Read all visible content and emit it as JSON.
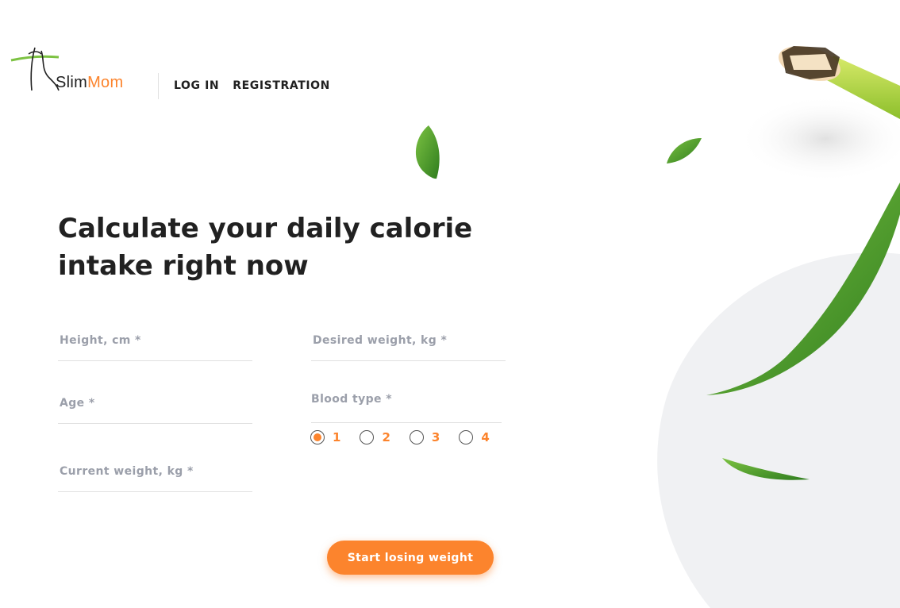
{
  "header": {
    "logo": {
      "text_slim": "Slim",
      "text_mom": "Mom"
    },
    "nav": [
      {
        "label": "LOG IN"
      },
      {
        "label": "REGISTRATION"
      }
    ]
  },
  "main": {
    "title": "Calculate your daily calorie intake right now",
    "form": {
      "height_placeholder": "Height, cm *",
      "age_placeholder": "Age *",
      "current_weight_placeholder": "Current weight, kg *",
      "desired_weight_placeholder": "Desired weight, kg *",
      "blood_type_label": "Blood type *",
      "blood_types": [
        {
          "value": "1",
          "selected": true
        },
        {
          "value": "2",
          "selected": false
        },
        {
          "value": "3",
          "selected": false
        },
        {
          "value": "4",
          "selected": false
        }
      ],
      "submit_label": "Start losing weight"
    }
  },
  "colors": {
    "accent": "#fc842d",
    "text": "#212121",
    "muted": "#9b9faa",
    "line": "#e0e0e0",
    "blob": "#f0f1f3",
    "leaf": "#5aa02c"
  },
  "icons": [
    "slimmom-logo-icon",
    "leaf-icon",
    "bamboo-stick-icon"
  ]
}
